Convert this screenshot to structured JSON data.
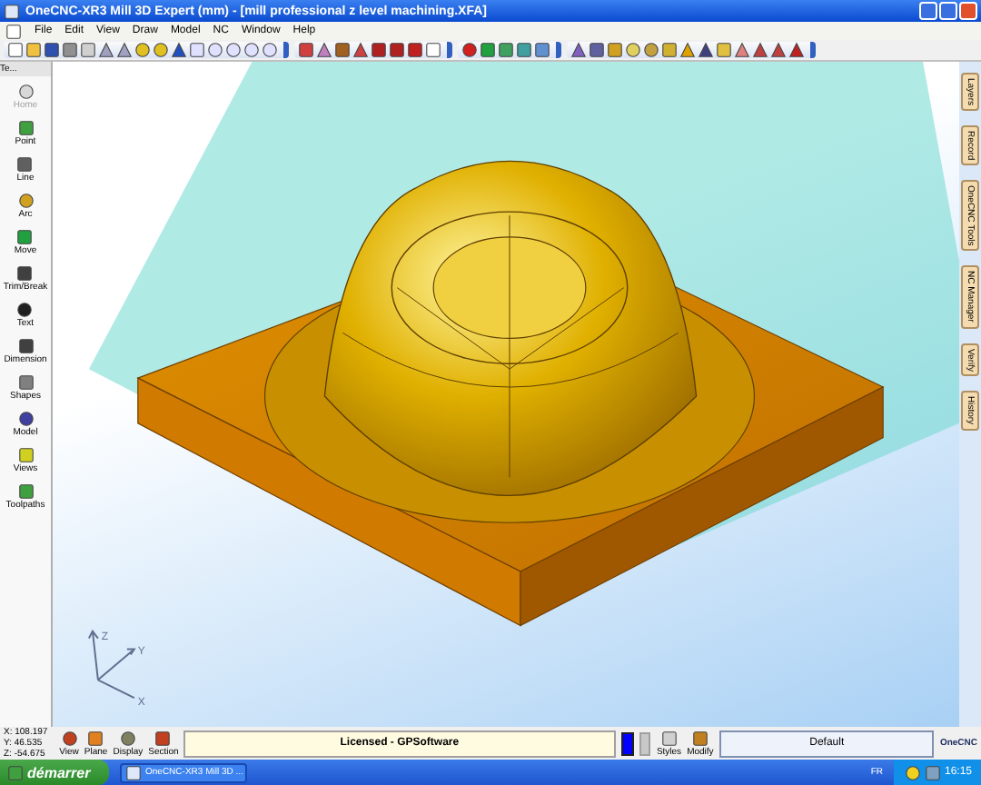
{
  "window": {
    "title": "OneCNC-XR3 Mill 3D Expert (mm) - [mill professional z level machining.XFA]"
  },
  "menu": [
    "File",
    "Edit",
    "View",
    "Draw",
    "Model",
    "NC",
    "Window",
    "Help"
  ],
  "panel": {
    "title": "Te..."
  },
  "tools": [
    {
      "label": "Home",
      "disabled": true
    },
    {
      "label": "Point",
      "disabled": false
    },
    {
      "label": "Line",
      "disabled": false
    },
    {
      "label": "Arc",
      "disabled": false
    },
    {
      "label": "Move",
      "disabled": false
    },
    {
      "label": "Trim/Break",
      "disabled": false
    },
    {
      "label": "Text",
      "disabled": false
    },
    {
      "label": "Dimension",
      "disabled": false
    },
    {
      "label": "Shapes",
      "disabled": false
    },
    {
      "label": "Model",
      "disabled": false
    },
    {
      "label": "Views",
      "disabled": false
    },
    {
      "label": "Toolpaths",
      "disabled": false
    }
  ],
  "side_tabs": [
    "Layers",
    "Record",
    "OneCNC Tools",
    "NC Manager",
    "Verify",
    "History"
  ],
  "axes": {
    "z": "Z",
    "y": "Y",
    "x": "X"
  },
  "coordinates": [
    "X: 108.197",
    "Y: 46.535",
    "Z: -54.675"
  ],
  "view_buttons": [
    "View",
    "Plane",
    "Display",
    "Section"
  ],
  "license": "Licensed - GPSoftware",
  "colors": [
    {
      "color": "#0000ff",
      "selected": true
    },
    {
      "color": "#c8c8c8",
      "selected": false
    }
  ],
  "style_buttons": [
    "Styles",
    "Modify"
  ],
  "style_field": "Default",
  "logo": "OneCNC",
  "taskbar": {
    "start": "démarrer",
    "task": "OneCNC-XR3 Mill 3D ...",
    "language": "FR",
    "clock": "16:15"
  }
}
